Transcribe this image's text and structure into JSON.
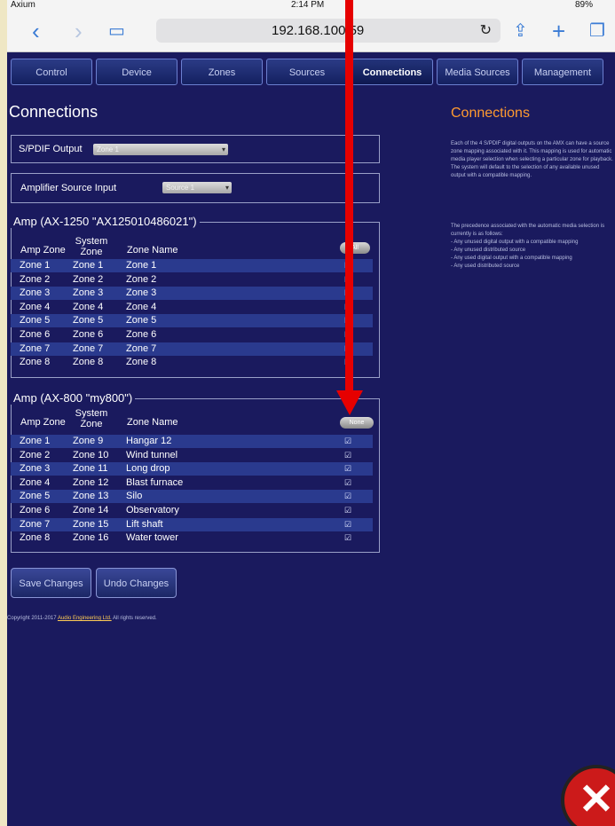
{
  "status_bar": {
    "carrier": "Axium",
    "time": "2:14 PM",
    "battery": "89%"
  },
  "browser": {
    "url": "192.168.100.59"
  },
  "tabs": [
    {
      "label": "Control"
    },
    {
      "label": "Device"
    },
    {
      "label": "Zones"
    },
    {
      "label": "Sources"
    },
    {
      "label": "Connections"
    },
    {
      "label": "Media Sources"
    },
    {
      "label": "Management"
    }
  ],
  "page_title": "Connections",
  "spdif": {
    "label": "S/PDIF Output",
    "value": "Zone 1"
  },
  "amp_source": {
    "label": "Amplifier Source Input",
    "value": "Source 1"
  },
  "amp1": {
    "legend": "Amp (AX-1250 \"AX125010486021\")",
    "col_amp": "Amp Zone",
    "col_system": "System Zone",
    "col_name": "Zone Name",
    "pill": "All",
    "rows": [
      {
        "amp": "Zone 1",
        "sys": "Zone 1",
        "name": "Zone 1"
      },
      {
        "amp": "Zone 2",
        "sys": "Zone 2",
        "name": "Zone 2"
      },
      {
        "amp": "Zone 3",
        "sys": "Zone 3",
        "name": "Zone 3"
      },
      {
        "amp": "Zone 4",
        "sys": "Zone 4",
        "name": "Zone 4"
      },
      {
        "amp": "Zone 5",
        "sys": "Zone 5",
        "name": "Zone 5"
      },
      {
        "amp": "Zone 6",
        "sys": "Zone 6",
        "name": "Zone 6"
      },
      {
        "amp": "Zone 7",
        "sys": "Zone 7",
        "name": "Zone 7"
      },
      {
        "amp": "Zone 8",
        "sys": "Zone 8",
        "name": "Zone 8"
      }
    ]
  },
  "amp2": {
    "legend": "Amp (AX-800 \"my800\")",
    "col_amp": "Amp Zone",
    "col_system": "System Zone",
    "col_name": "Zone Name",
    "pill": "None",
    "rows": [
      {
        "amp": "Zone 1",
        "sys": "Zone 9",
        "name": "Hangar 12"
      },
      {
        "amp": "Zone 2",
        "sys": "Zone 10",
        "name": "Wind tunnel"
      },
      {
        "amp": "Zone 3",
        "sys": "Zone 11",
        "name": "Long drop"
      },
      {
        "amp": "Zone 4",
        "sys": "Zone 12",
        "name": "Blast furnace"
      },
      {
        "amp": "Zone 5",
        "sys": "Zone 13",
        "name": "Silo"
      },
      {
        "amp": "Zone 6",
        "sys": "Zone 14",
        "name": "Observatory"
      },
      {
        "amp": "Zone 7",
        "sys": "Zone 15",
        "name": "Lift shaft"
      },
      {
        "amp": "Zone 8",
        "sys": "Zone 16",
        "name": "Water tower"
      }
    ]
  },
  "buttons": {
    "save": "Save Changes",
    "undo": "Undo Changes"
  },
  "copyright": {
    "prefix": "Copyright 2011-2017",
    "link": "Audio Engineering Ltd.",
    "suffix": "All rights reserved."
  },
  "sidebar": {
    "title": "Connections",
    "para1": "Each of the 4 S/PDIF digital outputs on the AMX can have a source zone mapping associated with it. This mapping is used for automatic media player selection when selecting a particular zone for playback. The system will default to the selection of any available unused output with a compatible mapping.",
    "para2": "The precedence associated with the automatic media selection is currently is as follows:",
    "bullets": [
      "- Any unused digital output with a compatible mapping",
      "- Any unused distributed source",
      "- Any used digital output with a compatible mapping",
      "- Any used distributed source"
    ]
  },
  "colors": {
    "page_bg": "#1a1a5e",
    "heading_accent": "#ff9a30",
    "annotation_arrow": "#e60000"
  }
}
